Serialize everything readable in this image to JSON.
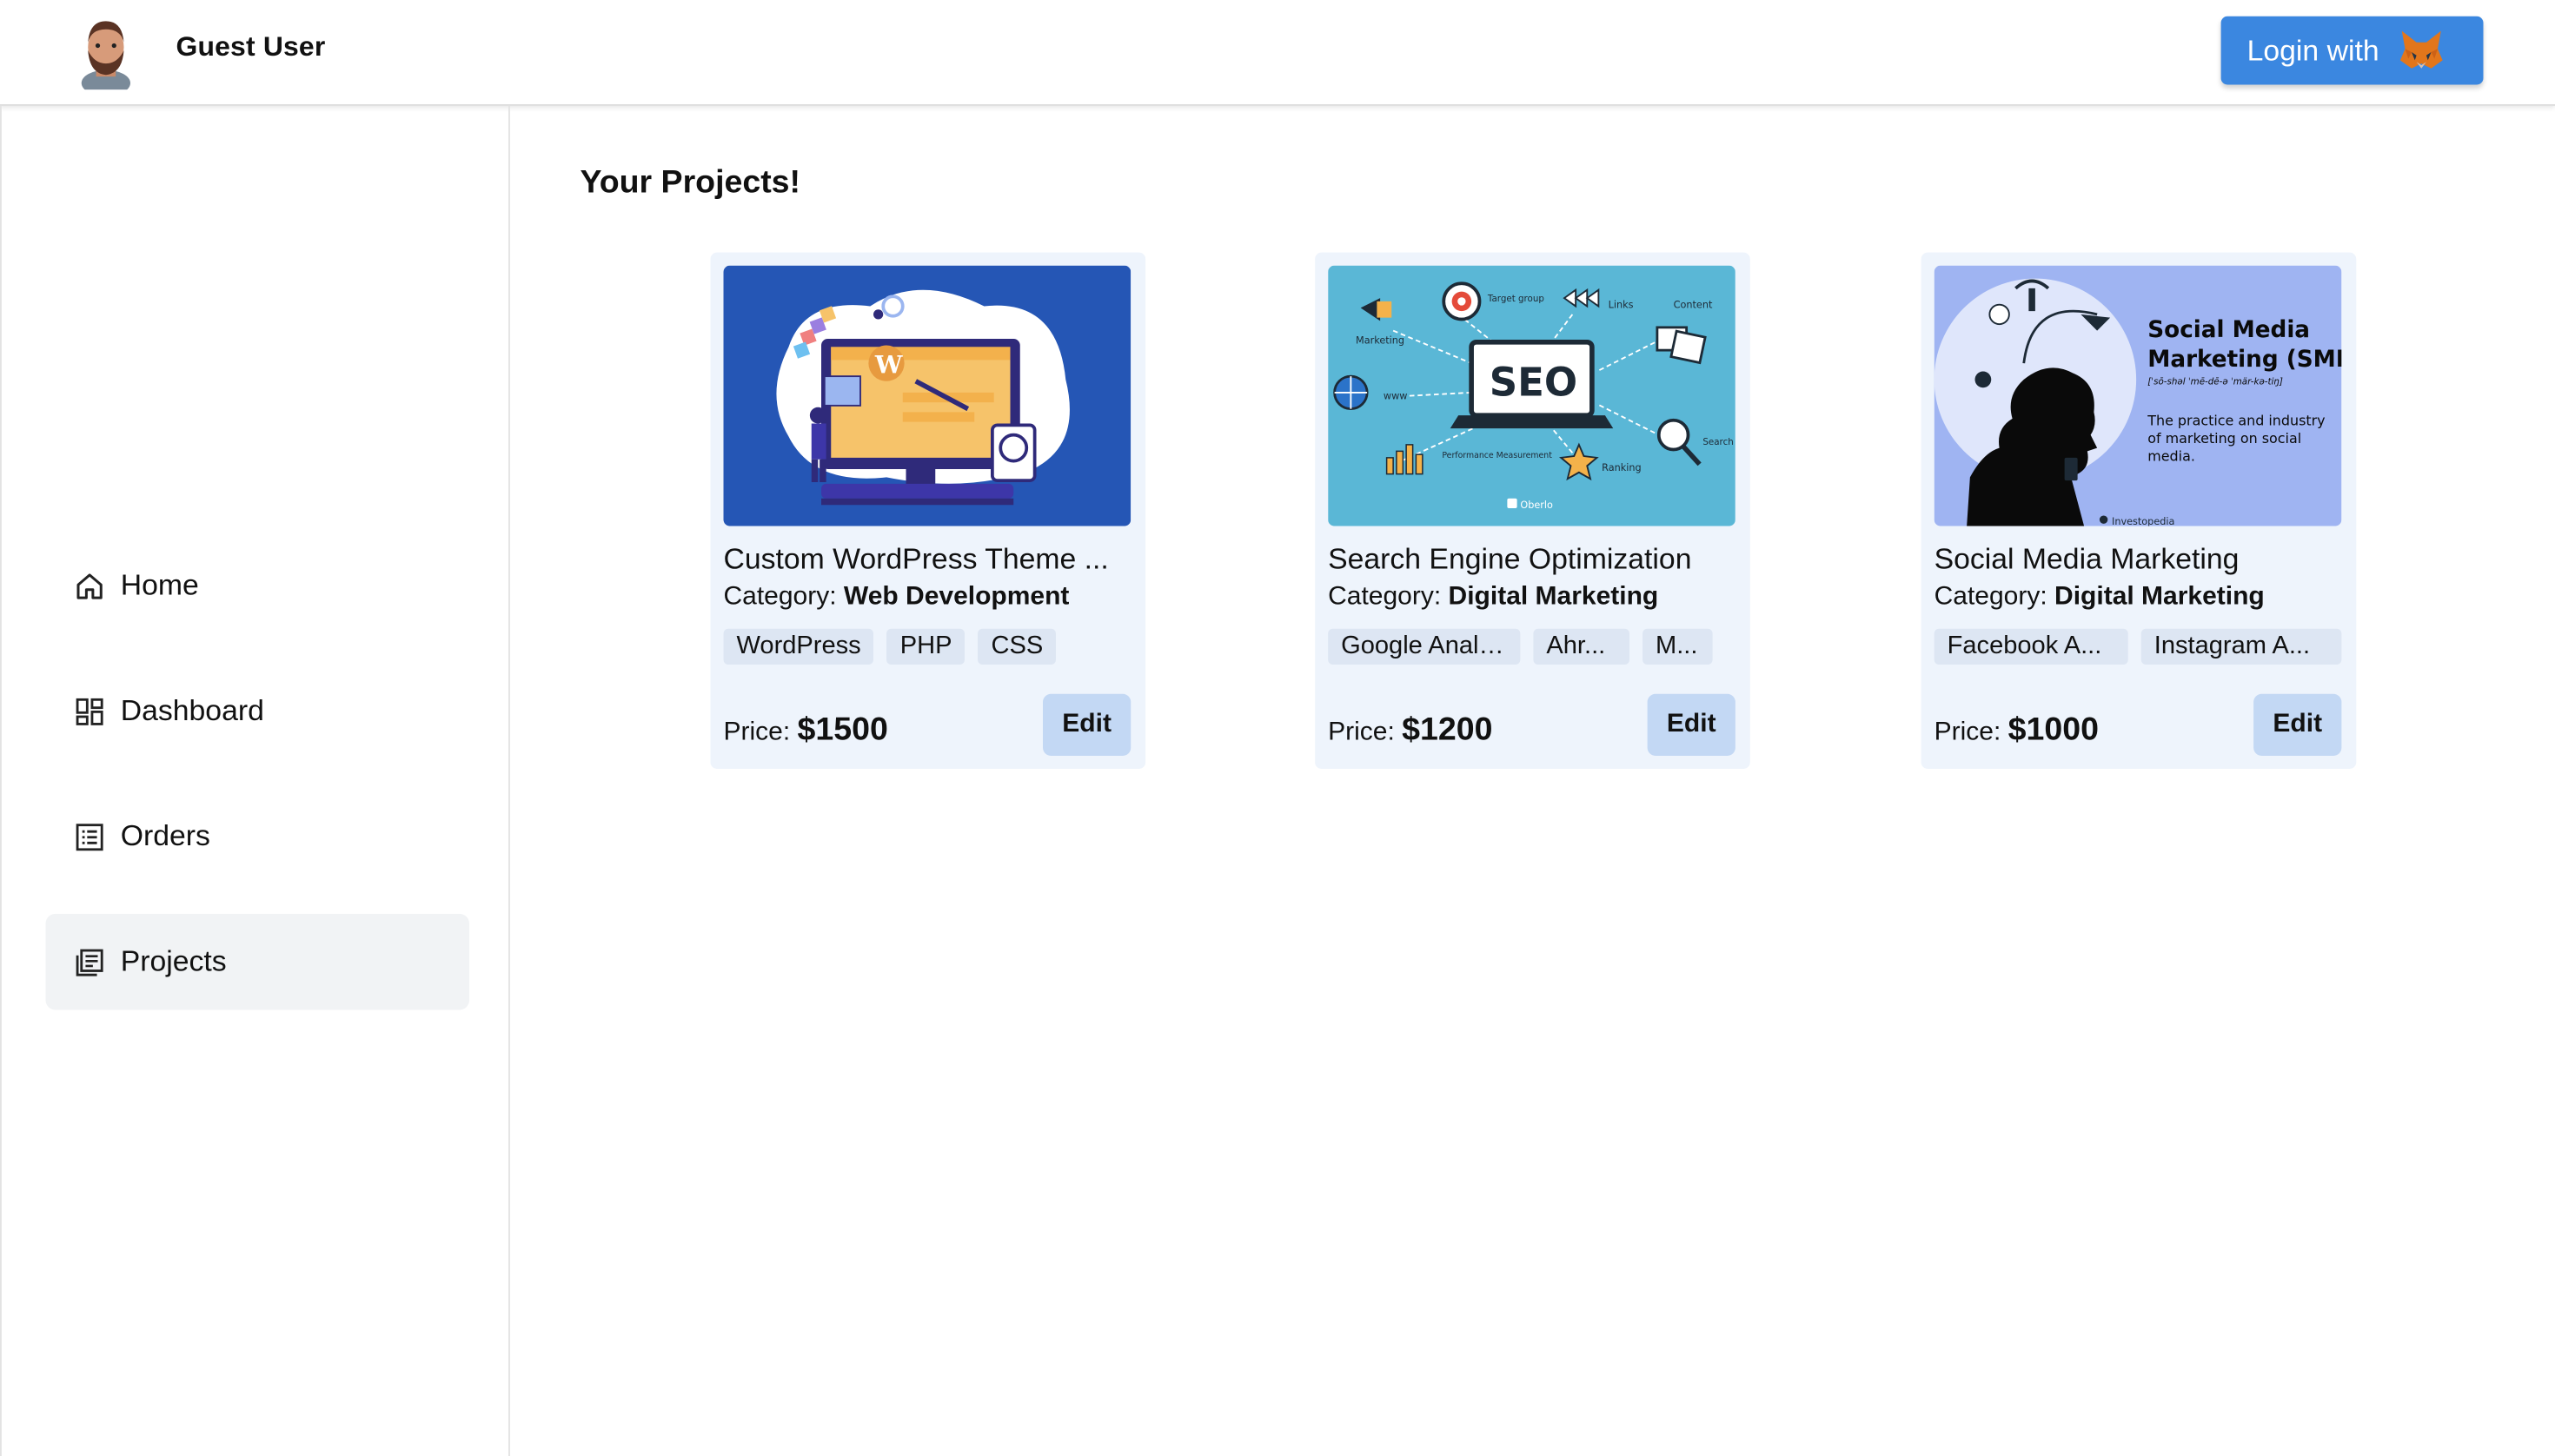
{
  "header": {
    "user_name": "Guest User",
    "avatar_icon": "user-avatar-icon",
    "login_label": "Login with",
    "login_icon": "metamask-fox-icon"
  },
  "sidebar": {
    "items": [
      {
        "label": "Home",
        "icon": "home-icon",
        "active": false
      },
      {
        "label": "Dashboard",
        "icon": "dashboard-icon",
        "active": false
      },
      {
        "label": "Orders",
        "icon": "orders-list-icon",
        "active": false
      },
      {
        "label": "Projects",
        "icon": "projects-icon",
        "active": true
      }
    ]
  },
  "main": {
    "title": "Your Projects!",
    "projects": [
      {
        "title": "Custom WordPress Theme ...",
        "category_label": "Category:",
        "category": "Web Development",
        "tags": [
          "WordPress",
          "PHP",
          "CSS"
        ],
        "price_label": "Price:",
        "price": "$1500",
        "edit_label": "Edit",
        "image": "wordpress-illustration"
      },
      {
        "title": "Search Engine Optimization",
        "category_label": "Category:",
        "category": "Digital Marketing",
        "tags": [
          "Google Analy...",
          "Ahr...",
          "M..."
        ],
        "price_label": "Price:",
        "price": "$1200",
        "edit_label": "Edit",
        "image": "seo-illustration",
        "image_text": {
          "center": "SEO",
          "labels": [
            "Marketing",
            "Target group",
            "Links",
            "Content",
            "www",
            "Performance Measurement",
            "Ranking",
            "Search"
          ],
          "brand": "Oberlo"
        }
      },
      {
        "title": "Social Media Marketing",
        "category_label": "Category:",
        "category": "Digital Marketing",
        "tags": [
          "Facebook A...",
          "Instagram A..."
        ],
        "price_label": "Price:",
        "price": "$1000",
        "edit_label": "Edit",
        "image": "social-media-illustration",
        "image_text": {
          "heading1": "Social Media",
          "heading2": "Marketing (SMM)",
          "phonetic": "[ˈsō-shəl ˈmē-dē-ə ˈmär-kə-tiŋ]",
          "desc1": "The practice and industry",
          "desc2": "of marketing on social",
          "desc3": "media.",
          "brand": "Investopedia"
        }
      }
    ]
  },
  "colors": {
    "accent": "#3b87e0",
    "card_bg": "#eef4fc",
    "edit_bg": "#c3d8f4",
    "tag_bg": "#dde6f3",
    "active_nav_bg": "#f1f3f5"
  }
}
